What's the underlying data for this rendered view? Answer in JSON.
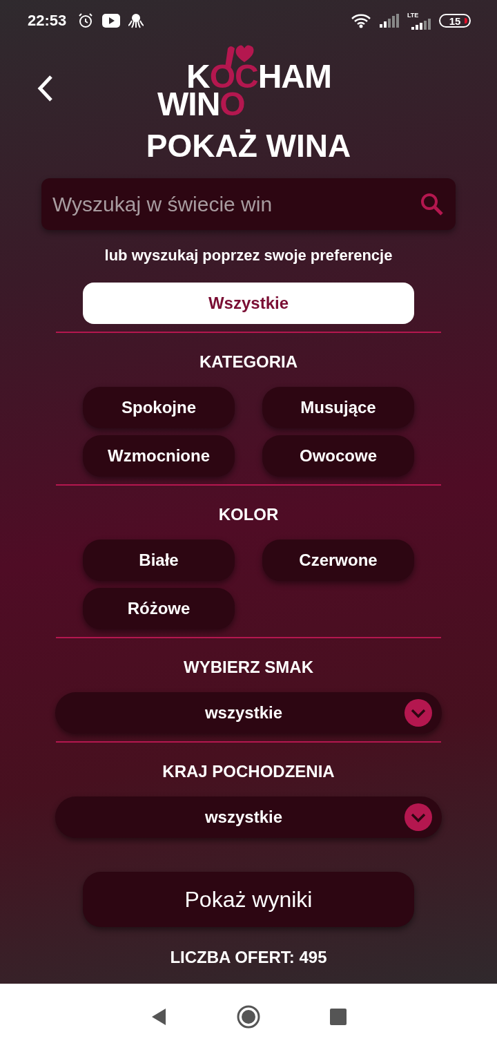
{
  "status_bar": {
    "time": "22:53",
    "network": "LTE",
    "battery": "15"
  },
  "header": {
    "logo": {
      "lines": [
        [
          {
            "text": "K",
            "accent": false
          },
          {
            "text": "OC",
            "accent": true
          },
          {
            "text": "HAM",
            "accent": false
          }
        ],
        [
          {
            "text": "WIN",
            "accent": false
          },
          {
            "text": "O",
            "accent": true
          }
        ]
      ]
    }
  },
  "title": "POKAŻ WINA",
  "search": {
    "placeholder": "Wyszukaj w świecie win"
  },
  "subtitle": "lub wyszukaj poprzez swoje preferencje",
  "all_button": {
    "label": "Wszystkie",
    "selected": true
  },
  "sections": [
    {
      "kind": "chips",
      "heading": "KATEGORIA",
      "options": [
        {
          "label": "Spokojne",
          "selected": false
        },
        {
          "label": "Musujące",
          "selected": false
        },
        {
          "label": "Wzmocnione",
          "selected": false
        },
        {
          "label": "Owocowe",
          "selected": false
        }
      ]
    },
    {
      "kind": "chips",
      "heading": "KOLOR",
      "options": [
        {
          "label": "Białe",
          "selected": false
        },
        {
          "label": "Czerwone",
          "selected": false
        },
        {
          "label": "Różowe",
          "selected": false
        }
      ]
    },
    {
      "kind": "dropdown",
      "heading": "WYBIERZ SMAK",
      "value": "wszystkie"
    },
    {
      "kind": "dropdown",
      "heading": "KRAJ POCHODZENIA",
      "value": "wszystkie"
    }
  ],
  "results_button": "Pokaż wyniki",
  "offer_count": "LICZBA OFERT: 495"
}
